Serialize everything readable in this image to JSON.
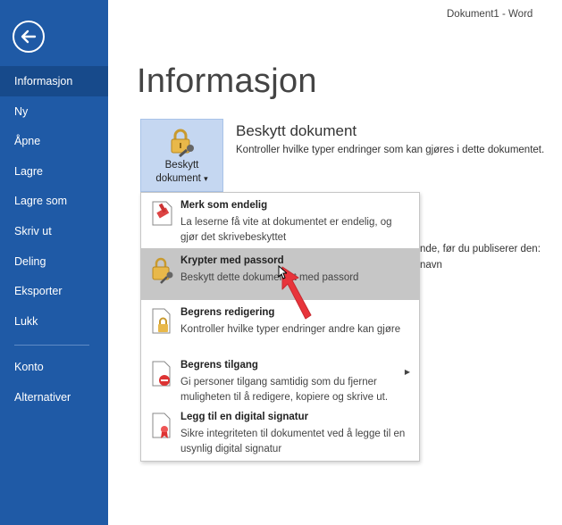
{
  "window": {
    "title": "Dokument1  -  Word"
  },
  "sidebar": {
    "items": [
      {
        "label": "Informasjon",
        "active": true
      },
      {
        "label": "Ny"
      },
      {
        "label": "Åpne"
      },
      {
        "label": "Lagre"
      },
      {
        "label": "Lagre som"
      },
      {
        "label": "Skriv ut"
      },
      {
        "label": "Deling"
      },
      {
        "label": "Eksporter"
      },
      {
        "label": "Lukk"
      },
      {
        "label": "Konto"
      },
      {
        "label": "Alternativer"
      }
    ]
  },
  "page": {
    "title": "Informasjon"
  },
  "protect": {
    "tile_line1": "Beskytt",
    "tile_line2": "dokument",
    "tile_caret": "▾",
    "heading": "Beskytt dokument",
    "description": "Kontroller hvilke typer endringer som kan gjøres i dette dokumentet."
  },
  "background_text": {
    "line1": "nde, før du publiserer den:",
    "line2": "navn"
  },
  "menu": {
    "items": [
      {
        "title": "Merk som endelig",
        "desc": "La leserne få vite at dokumentet er endelig, og gjør det skrivebeskyttet",
        "icon": "mark-final-icon"
      },
      {
        "title": "Krypter med passord",
        "desc": "Beskytt dette dokumentet med passord",
        "icon": "lock-key-icon",
        "hover": true
      },
      {
        "title": "Begrens redigering",
        "desc": "Kontroller hvilke typer endringer andre kan gjøre",
        "icon": "restrict-editing-icon"
      },
      {
        "title": "Begrens tilgang",
        "desc": "Gi personer tilgang samtidig som du fjerner muligheten til å redigere, kopiere og skrive ut.",
        "icon": "restrict-access-icon",
        "has_submenu": true
      },
      {
        "title": "Legg til en digital signatur",
        "desc": "Sikre integriteten til dokumentet ved å legge til en usynlig digital signatur",
        "icon": "digital-signature-icon"
      }
    ]
  },
  "colors": {
    "sidebar": "#1f5aa6",
    "sidebar_active": "#174a8b",
    "tile": "#c5d7f1",
    "hover": "#c6c6c6",
    "arrow": "#e8343b"
  }
}
